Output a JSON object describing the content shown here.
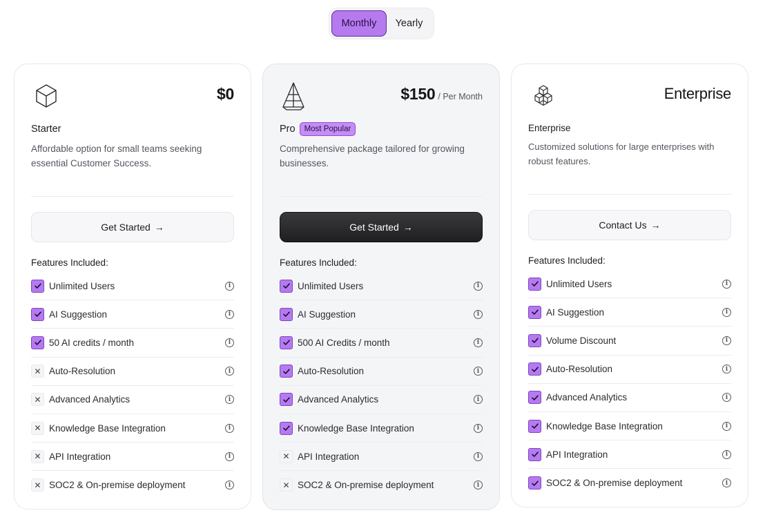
{
  "billing_toggle": {
    "monthly_label": "Monthly",
    "yearly_label": "Yearly",
    "selected": "Monthly"
  },
  "colors": {
    "accent": "#b67aef",
    "accent_border": "#5d2e9a",
    "dark_button": "#2a2a2d"
  },
  "plans": [
    {
      "icon": "cube-icon",
      "price": "$0",
      "price_suffix": "",
      "name": "Starter",
      "badge": "",
      "description": "Affordable option for small teams seeking essential Customer Success.",
      "cta_label": "Get Started",
      "features_title": "Features Included:",
      "features": [
        {
          "label": "Unlimited Users",
          "included": true
        },
        {
          "label": "AI Suggestion",
          "included": true
        },
        {
          "label": "50 AI credits / month",
          "included": true
        },
        {
          "label": "Auto-Resolution",
          "included": false
        },
        {
          "label": "Advanced Analytics",
          "included": false
        },
        {
          "label": "Knowledge Base Integration",
          "included": false
        },
        {
          "label": "API Integration",
          "included": false
        },
        {
          "label": "SOC2 & On-premise deployment",
          "included": false
        }
      ]
    },
    {
      "icon": "pyramid-icon",
      "price": "$150",
      "price_suffix": "/ Per Month",
      "name": "Pro",
      "badge": "Most Popular",
      "description": "Comprehensive package tailored for growing businesses.",
      "cta_label": "Get Started",
      "features_title": "Features Included:",
      "features": [
        {
          "label": "Unlimited Users",
          "included": true
        },
        {
          "label": "AI Suggestion",
          "included": true
        },
        {
          "label": "500 AI Credits / month",
          "included": true
        },
        {
          "label": "Auto-Resolution",
          "included": true
        },
        {
          "label": "Advanced Analytics",
          "included": true
        },
        {
          "label": "Knowledge Base Integration",
          "included": true
        },
        {
          "label": "API Integration",
          "included": false
        },
        {
          "label": "SOC2 & On-premise deployment",
          "included": false
        }
      ]
    },
    {
      "icon": "stacked-cubes-icon",
      "price": "Enterprise",
      "price_suffix": "",
      "name": "Enterprise",
      "badge": "",
      "description": "Customized solutions for large enterprises with robust features.",
      "cta_label": "Contact Us",
      "features_title": "Features Included:",
      "features": [
        {
          "label": "Unlimited Users",
          "included": true
        },
        {
          "label": "AI Suggestion",
          "included": true
        },
        {
          "label": "Volume Discount",
          "included": true
        },
        {
          "label": "Auto-Resolution",
          "included": true
        },
        {
          "label": "Advanced Analytics",
          "included": true
        },
        {
          "label": "Knowledge Base Integration",
          "included": true
        },
        {
          "label": "API Integration",
          "included": true
        },
        {
          "label": "SOC2 & On-premise deployment",
          "included": true
        }
      ]
    }
  ]
}
